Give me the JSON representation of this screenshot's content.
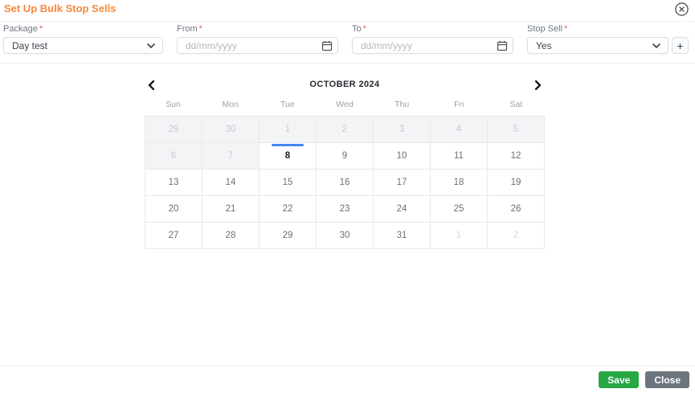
{
  "colors": {
    "title_orange": "#f6883d",
    "required_red": "#ee5a5a",
    "today_bar_blue": "#4285f4",
    "save_green": "#28a745",
    "close_gray": "#6c757d"
  },
  "modal": {
    "title": "Set Up Bulk Stop Sells"
  },
  "form": {
    "package": {
      "label": "Package",
      "required_mark": "*",
      "value": "Day test"
    },
    "from": {
      "label": "From",
      "required_mark": "*",
      "placeholder": "dd/mm/yyyy"
    },
    "to": {
      "label": "To",
      "required_mark": "*",
      "placeholder": "dd/mm/yyyy"
    },
    "stop_sell": {
      "label": "Stop Sell",
      "required_mark": "*",
      "value": "Yes"
    },
    "add_row_label": "+"
  },
  "calendar": {
    "month_label": "OCTOBER 2024",
    "day_headers": [
      "Sun",
      "Mon",
      "Tue",
      "Wed",
      "Thu",
      "Fri",
      "Sat"
    ],
    "weeks": [
      [
        {
          "day": "29",
          "state": "past"
        },
        {
          "day": "30",
          "state": "past"
        },
        {
          "day": "1",
          "state": "past"
        },
        {
          "day": "2",
          "state": "past"
        },
        {
          "day": "3",
          "state": "past"
        },
        {
          "day": "4",
          "state": "past"
        },
        {
          "day": "5",
          "state": "past"
        }
      ],
      [
        {
          "day": "6",
          "state": "past"
        },
        {
          "day": "7",
          "state": "past"
        },
        {
          "day": "8",
          "state": "today"
        },
        {
          "day": "9",
          "state": "active"
        },
        {
          "day": "10",
          "state": "active"
        },
        {
          "day": "11",
          "state": "active"
        },
        {
          "day": "12",
          "state": "active"
        }
      ],
      [
        {
          "day": "13",
          "state": "active"
        },
        {
          "day": "14",
          "state": "active"
        },
        {
          "day": "15",
          "state": "active"
        },
        {
          "day": "16",
          "state": "active"
        },
        {
          "day": "17",
          "state": "active"
        },
        {
          "day": "18",
          "state": "active"
        },
        {
          "day": "19",
          "state": "active"
        }
      ],
      [
        {
          "day": "20",
          "state": "active"
        },
        {
          "day": "21",
          "state": "active"
        },
        {
          "day": "22",
          "state": "active"
        },
        {
          "day": "23",
          "state": "active"
        },
        {
          "day": "24",
          "state": "active"
        },
        {
          "day": "25",
          "state": "active"
        },
        {
          "day": "26",
          "state": "active"
        }
      ],
      [
        {
          "day": "27",
          "state": "active"
        },
        {
          "day": "28",
          "state": "active"
        },
        {
          "day": "29",
          "state": "active"
        },
        {
          "day": "30",
          "state": "active"
        },
        {
          "day": "31",
          "state": "active"
        },
        {
          "day": "1",
          "state": "next"
        },
        {
          "day": "2",
          "state": "next"
        }
      ]
    ]
  },
  "footer": {
    "save_label": "Save",
    "close_label": "Close"
  }
}
